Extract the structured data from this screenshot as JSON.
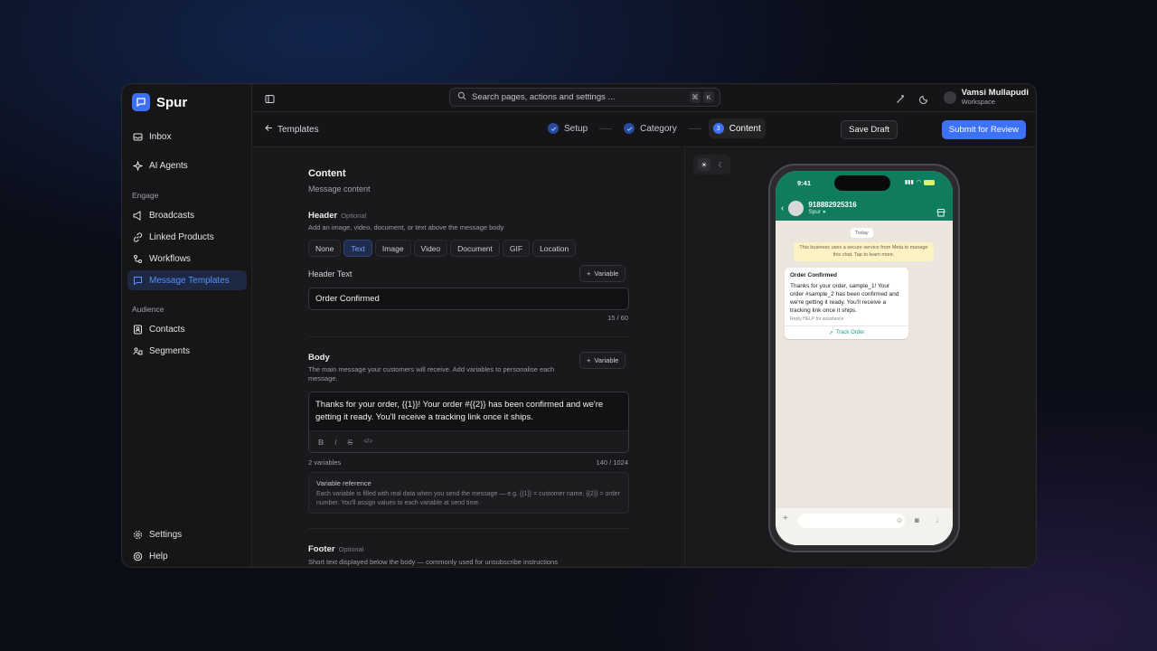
{
  "app": {
    "name": "Spur"
  },
  "sidebar": {
    "top_items": [
      {
        "label": "Inbox",
        "icon": "inbox-icon"
      },
      {
        "label": "AI Agents",
        "icon": "sparkle-icon"
      }
    ],
    "sections": [
      {
        "title": "Engage",
        "items": [
          {
            "label": "Broadcasts",
            "icon": "megaphone-icon"
          },
          {
            "label": "Linked Products",
            "icon": "link-icon"
          },
          {
            "label": "Workflows",
            "icon": "workflow-icon"
          },
          {
            "label": "Message Templates",
            "icon": "message-square-icon",
            "active": true
          }
        ]
      },
      {
        "title": "Audience",
        "items": [
          {
            "label": "Contacts",
            "icon": "contacts-icon"
          },
          {
            "label": "Segments",
            "icon": "segments-icon"
          }
        ]
      }
    ],
    "bottom_items": [
      {
        "label": "Settings",
        "icon": "gear-icon"
      },
      {
        "label": "Help",
        "icon": "help-icon"
      }
    ]
  },
  "topbar": {
    "search_placeholder": "Search pages, actions and settings ...",
    "shortcut": [
      "⌘",
      "K"
    ],
    "user_name": "Vamsi Mullapudi",
    "user_sub": "Workspace"
  },
  "subheader": {
    "back_label": "Templates",
    "steps": [
      {
        "label": "Setup",
        "state": "done"
      },
      {
        "label": "Category",
        "state": "done"
      },
      {
        "label": "Content",
        "state": "current",
        "number": "3"
      }
    ],
    "save_draft": "Save Draft",
    "submit": "Submit for Review"
  },
  "form": {
    "title": "Content",
    "subtitle": "Message content",
    "header": {
      "label": "Header",
      "optional": "Optional",
      "help": "Add an image, video, document, or text above the message body",
      "types": [
        "None",
        "Text",
        "Image",
        "Video",
        "Document",
        "GIF",
        "Location"
      ],
      "selected": "Text",
      "text_label": "Header Text",
      "variable_button": "Variable",
      "value": "Order Confirmed",
      "counter": "15 / 60"
    },
    "body": {
      "label": "Body",
      "help": "The main message your customers will receive. Add variables to personalise each message.",
      "variable_button": "Variable",
      "value": "Thanks for your order, {{1}}! Your order #{{2}} has been confirmed and we're getting it ready. You'll receive a tracking link once it ships.",
      "toolbar": [
        "B",
        "I",
        "S",
        "</>"
      ],
      "variables_count": "2 variables",
      "counter": "140 / 1024",
      "reference_title": "Variable reference",
      "reference_text": "Each variable is filled with real data when you send the message — e.g. {{1}} = customer name, {{2}} = order number. You'll assign values to each variable at send time."
    },
    "footer": {
      "label": "Footer",
      "optional": "Optional",
      "help": "Short text displayed below the body — commonly used for unsubscribe instructions"
    }
  },
  "preview": {
    "time": "9:41",
    "contact_number": "918882925316",
    "contact_sub": "Spur",
    "date_chip": "Today",
    "system_notice": "This business uses a secure service from Meta to manage this chat. Tap to learn more.",
    "message": {
      "title": "Order Confirmed",
      "body": "Thanks for your order, sample_1! Your order #sample_2 has been confirmed and we're getting it ready. You'll receive a tracking link once it ships.",
      "footer": "Reply HELP for assistance",
      "button": "Track Order"
    },
    "colors": {
      "accent": "#3e72f6",
      "whatsapp_green": "#0e7c5d"
    }
  }
}
